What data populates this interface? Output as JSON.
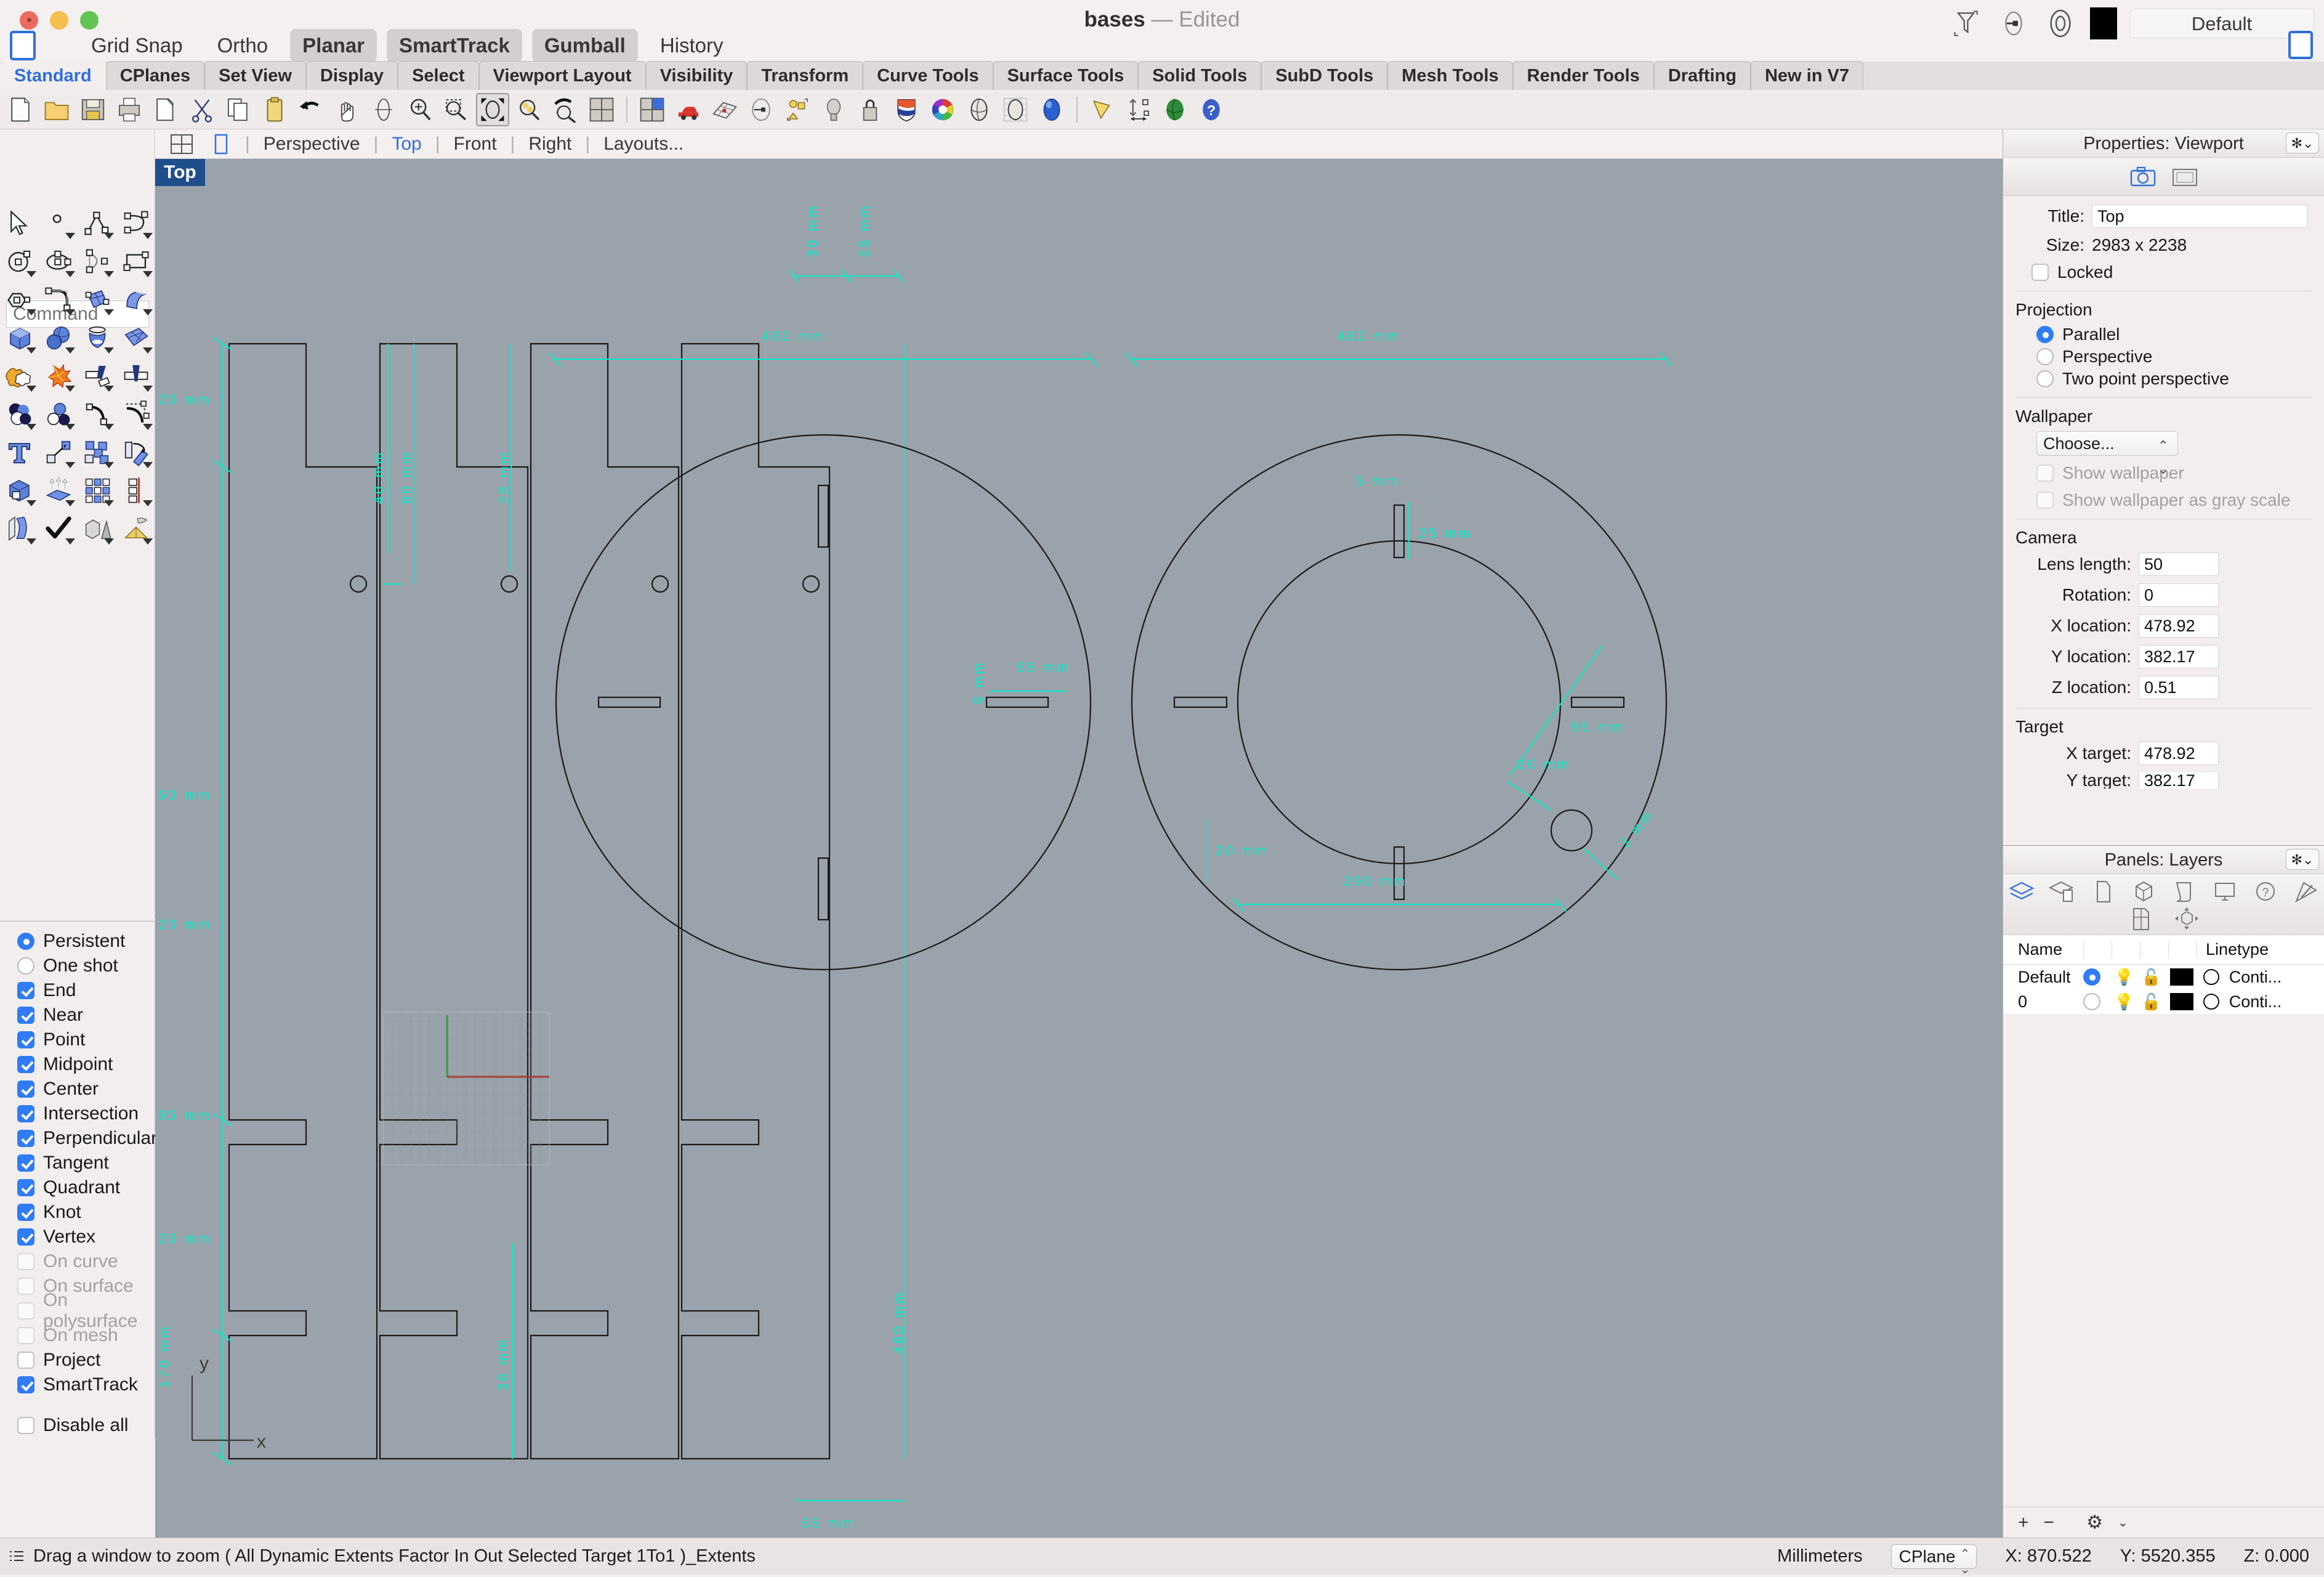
{
  "window": {
    "title_name": "bases",
    "title_dash": "—",
    "title_state": "Edited"
  },
  "modes": [
    {
      "label": "Grid Snap",
      "active": false
    },
    {
      "label": "Ortho",
      "active": false
    },
    {
      "label": "Planar",
      "active": true
    },
    {
      "label": "SmartTrack",
      "active": true
    },
    {
      "label": "Gumball",
      "active": true
    },
    {
      "label": "History",
      "active": false
    }
  ],
  "header_right": {
    "material_label": "Default",
    "color_swatch": "#000000"
  },
  "tabs": [
    {
      "label": "Standard",
      "active": true
    },
    {
      "label": "CPlanes",
      "active": false
    },
    {
      "label": "Set View",
      "active": false
    },
    {
      "label": "Display",
      "active": false
    },
    {
      "label": "Select",
      "active": false
    },
    {
      "label": "Viewport Layout",
      "active": false
    },
    {
      "label": "Visibility",
      "active": false
    },
    {
      "label": "Transform",
      "active": false
    },
    {
      "label": "Curve Tools",
      "active": false
    },
    {
      "label": "Surface Tools",
      "active": false
    },
    {
      "label": "Solid Tools",
      "active": false
    },
    {
      "label": "SubD Tools",
      "active": false
    },
    {
      "label": "Mesh Tools",
      "active": false
    },
    {
      "label": "Render Tools",
      "active": false
    },
    {
      "label": "Drafting",
      "active": false
    },
    {
      "label": "New in V7",
      "active": false
    }
  ],
  "command": {
    "placeholder": "Command",
    "value": ""
  },
  "viewport_tabs": [
    {
      "label": "Perspective",
      "active": false
    },
    {
      "label": "Top",
      "active": true
    },
    {
      "label": "Front",
      "active": false
    },
    {
      "label": "Right",
      "active": false
    },
    {
      "label": "Layouts...",
      "active": false
    }
  ],
  "viewport": {
    "label": "Top",
    "axis_x": "x",
    "axis_y": "y"
  },
  "osnap": {
    "mode_items": [
      {
        "label": "Persistent",
        "checked": true
      },
      {
        "label": "One shot",
        "checked": false
      }
    ],
    "items": [
      {
        "label": "End",
        "checked": true,
        "disabled": false
      },
      {
        "label": "Near",
        "checked": true,
        "disabled": false
      },
      {
        "label": "Point",
        "checked": true,
        "disabled": false
      },
      {
        "label": "Midpoint",
        "checked": true,
        "disabled": false
      },
      {
        "label": "Center",
        "checked": true,
        "disabled": false
      },
      {
        "label": "Intersection",
        "checked": true,
        "disabled": false
      },
      {
        "label": "Perpendicular",
        "checked": true,
        "disabled": false
      },
      {
        "label": "Tangent",
        "checked": true,
        "disabled": false
      },
      {
        "label": "Quadrant",
        "checked": true,
        "disabled": false
      },
      {
        "label": "Knot",
        "checked": true,
        "disabled": false
      },
      {
        "label": "Vertex",
        "checked": true,
        "disabled": false
      },
      {
        "label": "On curve",
        "checked": false,
        "disabled": true
      },
      {
        "label": "On surface",
        "checked": false,
        "disabled": true
      },
      {
        "label": "On polysurface",
        "checked": false,
        "disabled": true
      },
      {
        "label": "On mesh",
        "checked": false,
        "disabled": true
      },
      {
        "label": "Project",
        "checked": false,
        "disabled": false
      },
      {
        "label": "SmartTrack",
        "checked": true,
        "disabled": false
      }
    ],
    "disable_all": {
      "label": "Disable all",
      "checked": false
    }
  },
  "properties": {
    "panel_title": "Properties: Viewport",
    "title_label": "Title:",
    "title_value": "Top",
    "size_label": "Size:",
    "size_value": "2983 x 2238",
    "locked_label": "Locked",
    "locked_checked": false,
    "projection_header": "Projection",
    "projection_options": [
      {
        "label": "Parallel",
        "selected": true
      },
      {
        "label": "Perspective",
        "selected": false
      },
      {
        "label": "Two point perspective",
        "selected": false
      }
    ],
    "wallpaper_header": "Wallpaper",
    "wallpaper_choose": "Choose...",
    "show_wallpaper_label": "Show wallpaper",
    "show_wallpaper_checked": false,
    "show_wallpaper_gray_label": "Show wallpaper as gray scale",
    "show_wallpaper_gray_checked": false,
    "camera_header": "Camera",
    "camera_fields": [
      {
        "label": "Lens length:",
        "value": "50"
      },
      {
        "label": "Rotation:",
        "value": "0"
      },
      {
        "label": "X location:",
        "value": "478.92"
      },
      {
        "label": "Y location:",
        "value": "382.17"
      },
      {
        "label": "Z location:",
        "value": "0.51"
      }
    ],
    "target_header": "Target",
    "target_fields": [
      {
        "label": "X target:",
        "value": "478.92"
      },
      {
        "label": "Y target:",
        "value": "382.17"
      }
    ]
  },
  "layers": {
    "panel_title": "Panels: Layers",
    "columns": [
      "Name",
      "Linetype"
    ],
    "rows": [
      {
        "name": "Default",
        "current": true,
        "linetype": "Conti..."
      },
      {
        "name": "0",
        "current": false,
        "linetype": "Conti..."
      }
    ],
    "footer": {
      "add": "+",
      "remove": "−",
      "gear": "⚙"
    }
  },
  "statusbar": {
    "prompt": "Drag a window to zoom ( All Dynamic Extents Factor In Out Selected Target 1To1 )_Extents",
    "units": "Millimeters",
    "cplane": "CPlane",
    "x": "X: 870.522",
    "y": "Y: 5520.355",
    "z": "Z: 0.000"
  },
  "drawing": {
    "units": "mm",
    "accent_color": "#00f0c8",
    "line_color": "#1a1a1a",
    "background_color": "#9aa2ab",
    "dimensions": {
      "profile_vertical_chain": [
        "20 mm",
        "60 mm",
        "20 mm",
        "85 mm",
        "20 mm"
      ],
      "profile_total_left": "170 mm",
      "profile_total_right": "480 mm",
      "profile_width_bottom": "55 mm",
      "profile_rotated": [
        "40 mm",
        "80 mm",
        "28 mm",
        "30 mm",
        "25 mm",
        "36 mm"
      ],
      "disc_left_diameter": "482 mm",
      "disc_left_slot": "55 mm",
      "disc_right_diameter": "482 mm",
      "disc_right_inner": "290 mm",
      "disc_right_slot_width": "5 mm",
      "disc_right_slot_height": "25 mm",
      "disc_right_radius": "95 mm",
      "disc_right_hole_edge": "20 mm",
      "disc_right_hole_edge2": "20 mm",
      "disc_right_hole_dia": "3 mm"
    }
  }
}
